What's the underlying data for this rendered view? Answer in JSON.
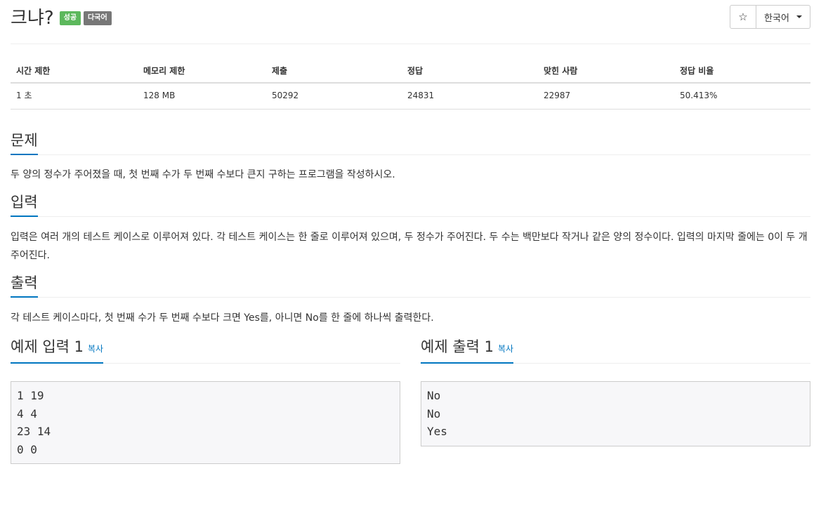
{
  "problem": {
    "title": "크냐?",
    "badges": {
      "success": "성공",
      "multilang": "다국어"
    },
    "star_icon": "☆",
    "language": "한국어"
  },
  "stats": {
    "headers": [
      "시간 제한",
      "메모리 제한",
      "제출",
      "정답",
      "맞힌 사람",
      "정답 비율"
    ],
    "values": [
      "1 초",
      "128 MB",
      "50292",
      "24831",
      "22987",
      "50.413%"
    ]
  },
  "sections": {
    "description": {
      "title": "문제",
      "text": "두 양의 정수가 주어졌을 때, 첫 번째 수가 두 번째 수보다 큰지 구하는 프로그램을 작성하시오."
    },
    "input": {
      "title": "입력",
      "text": "입력은 여러 개의 테스트 케이스로 이루어져 있다. 각 테스트 케이스는 한 줄로 이루어져 있으며, 두 정수가 주어진다. 두 수는 백만보다 작거나 같은 양의 정수이다. 입력의 마지막 줄에는 0이 두 개 주어진다."
    },
    "output": {
      "title": "출력",
      "text": "각 테스트 케이스마다, 첫 번째 수가 두 번째 수보다 크면 Yes를, 아니면 No를 한 줄에 하나씩 출력한다."
    }
  },
  "samples": {
    "input": {
      "title": "예제 입력 1",
      "copy_label": "복사",
      "content": "1 19\n4 4\n23 14\n0 0"
    },
    "output": {
      "title": "예제 출력 1",
      "copy_label": "복사",
      "content": "No\nNo\nYes"
    }
  },
  "colors": {
    "accent": "#0076c0",
    "badge_success": "#5cb85c",
    "badge_multilang": "#777777"
  }
}
